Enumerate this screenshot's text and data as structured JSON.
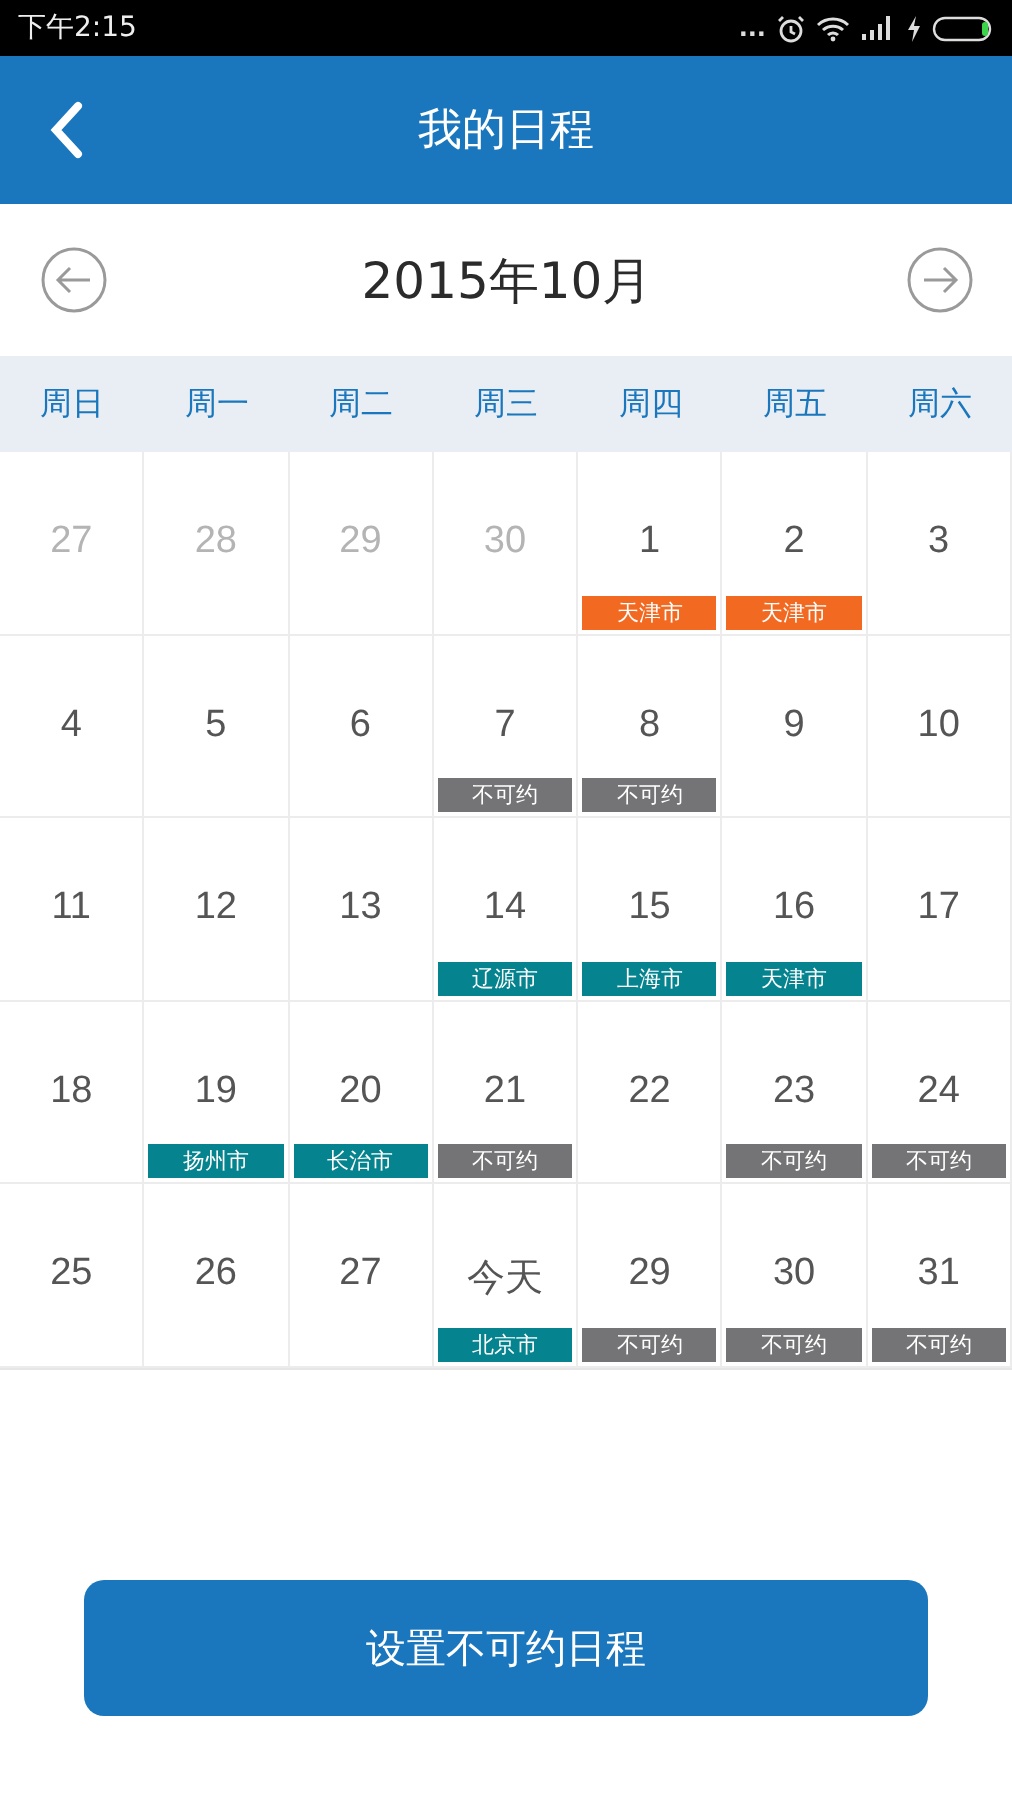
{
  "status_bar": {
    "time": "下午2:15",
    "more": "..."
  },
  "header": {
    "title": "我的日程"
  },
  "month_nav": {
    "title": "2015年10月"
  },
  "weekdays": [
    "周日",
    "周一",
    "周二",
    "周三",
    "周四",
    "周五",
    "周六"
  ],
  "days": [
    {
      "day": "27",
      "muted": true
    },
    {
      "day": "28",
      "muted": true
    },
    {
      "day": "29",
      "muted": true
    },
    {
      "day": "30",
      "muted": true
    },
    {
      "day": "1",
      "muted": false,
      "tag": {
        "label": "天津市",
        "color": "#f26a21"
      }
    },
    {
      "day": "2",
      "muted": false,
      "tag": {
        "label": "天津市",
        "color": "#f26a21"
      }
    },
    {
      "day": "3",
      "muted": false
    },
    {
      "day": "4",
      "muted": false
    },
    {
      "day": "5",
      "muted": false
    },
    {
      "day": "6",
      "muted": false
    },
    {
      "day": "7",
      "muted": false,
      "tag": {
        "label": "不可约",
        "color": "#747476"
      }
    },
    {
      "day": "8",
      "muted": false,
      "tag": {
        "label": "不可约",
        "color": "#747476"
      }
    },
    {
      "day": "9",
      "muted": false
    },
    {
      "day": "10",
      "muted": false
    },
    {
      "day": "11",
      "muted": false
    },
    {
      "day": "12",
      "muted": false
    },
    {
      "day": "13",
      "muted": false
    },
    {
      "day": "14",
      "muted": false,
      "tag": {
        "label": "辽源市",
        "color": "#05838e"
      }
    },
    {
      "day": "15",
      "muted": false,
      "tag": {
        "label": "上海市",
        "color": "#05838e"
      }
    },
    {
      "day": "16",
      "muted": false,
      "tag": {
        "label": "天津市",
        "color": "#05838e"
      }
    },
    {
      "day": "17",
      "muted": false
    },
    {
      "day": "18",
      "muted": false
    },
    {
      "day": "19",
      "muted": false,
      "tag": {
        "label": "扬州市",
        "color": "#05838e"
      }
    },
    {
      "day": "20",
      "muted": false,
      "tag": {
        "label": "长治市",
        "color": "#05838e"
      }
    },
    {
      "day": "21",
      "muted": false,
      "tag": {
        "label": "不可约",
        "color": "#747476"
      }
    },
    {
      "day": "22",
      "muted": false
    },
    {
      "day": "23",
      "muted": false,
      "tag": {
        "label": "不可约",
        "color": "#747476"
      }
    },
    {
      "day": "24",
      "muted": false,
      "tag": {
        "label": "不可约",
        "color": "#747476"
      }
    },
    {
      "day": "25",
      "muted": false
    },
    {
      "day": "26",
      "muted": false
    },
    {
      "day": "27",
      "muted": false
    },
    {
      "day": "今天",
      "muted": false,
      "tag": {
        "label": "北京市",
        "color": "#05838e"
      }
    },
    {
      "day": "29",
      "muted": false,
      "tag": {
        "label": "不可约",
        "color": "#747476"
      }
    },
    {
      "day": "30",
      "muted": false,
      "tag": {
        "label": "不可约",
        "color": "#747476"
      }
    },
    {
      "day": "31",
      "muted": false,
      "tag": {
        "label": "不可约",
        "color": "#747476"
      }
    }
  ],
  "action_button": {
    "label": "设置不可约日程"
  }
}
